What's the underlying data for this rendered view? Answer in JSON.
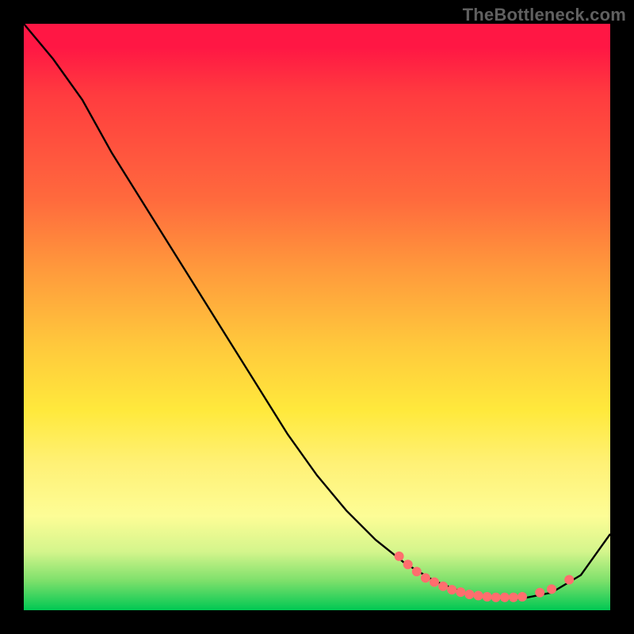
{
  "watermark": "TheBottleneck.com",
  "chart_data": {
    "type": "line",
    "title": "",
    "xlabel": "",
    "ylabel": "",
    "xlim": [
      0,
      1
    ],
    "ylim": [
      0,
      1
    ],
    "note": "Axes are normalized 0–1; the image has no visible tick labels or axis titles.",
    "series": [
      {
        "name": "curve",
        "x": [
          0.0,
          0.05,
          0.1,
          0.15,
          0.2,
          0.25,
          0.3,
          0.35,
          0.4,
          0.45,
          0.5,
          0.55,
          0.6,
          0.65,
          0.7,
          0.75,
          0.8,
          0.85,
          0.9,
          0.95,
          1.0
        ],
        "y": [
          1.0,
          0.94,
          0.87,
          0.78,
          0.7,
          0.62,
          0.54,
          0.46,
          0.38,
          0.3,
          0.23,
          0.17,
          0.12,
          0.08,
          0.05,
          0.03,
          0.02,
          0.02,
          0.03,
          0.06,
          0.13
        ],
        "color": "#000000"
      }
    ],
    "markers": [
      {
        "x": 0.64,
        "y": 0.092
      },
      {
        "x": 0.655,
        "y": 0.078
      },
      {
        "x": 0.67,
        "y": 0.066
      },
      {
        "x": 0.685,
        "y": 0.055
      },
      {
        "x": 0.7,
        "y": 0.048
      },
      {
        "x": 0.715,
        "y": 0.041
      },
      {
        "x": 0.73,
        "y": 0.035
      },
      {
        "x": 0.745,
        "y": 0.031
      },
      {
        "x": 0.76,
        "y": 0.027
      },
      {
        "x": 0.775,
        "y": 0.025
      },
      {
        "x": 0.79,
        "y": 0.023
      },
      {
        "x": 0.805,
        "y": 0.022
      },
      {
        "x": 0.82,
        "y": 0.022
      },
      {
        "x": 0.835,
        "y": 0.022
      },
      {
        "x": 0.85,
        "y": 0.023
      },
      {
        "x": 0.88,
        "y": 0.03
      },
      {
        "x": 0.9,
        "y": 0.036
      },
      {
        "x": 0.93,
        "y": 0.052
      }
    ],
    "marker_color": "#ff6e6e",
    "background_gradient": [
      "#ff1744",
      "#ff6a3d",
      "#ffc93c",
      "#fdfd96",
      "#00c853"
    ]
  }
}
